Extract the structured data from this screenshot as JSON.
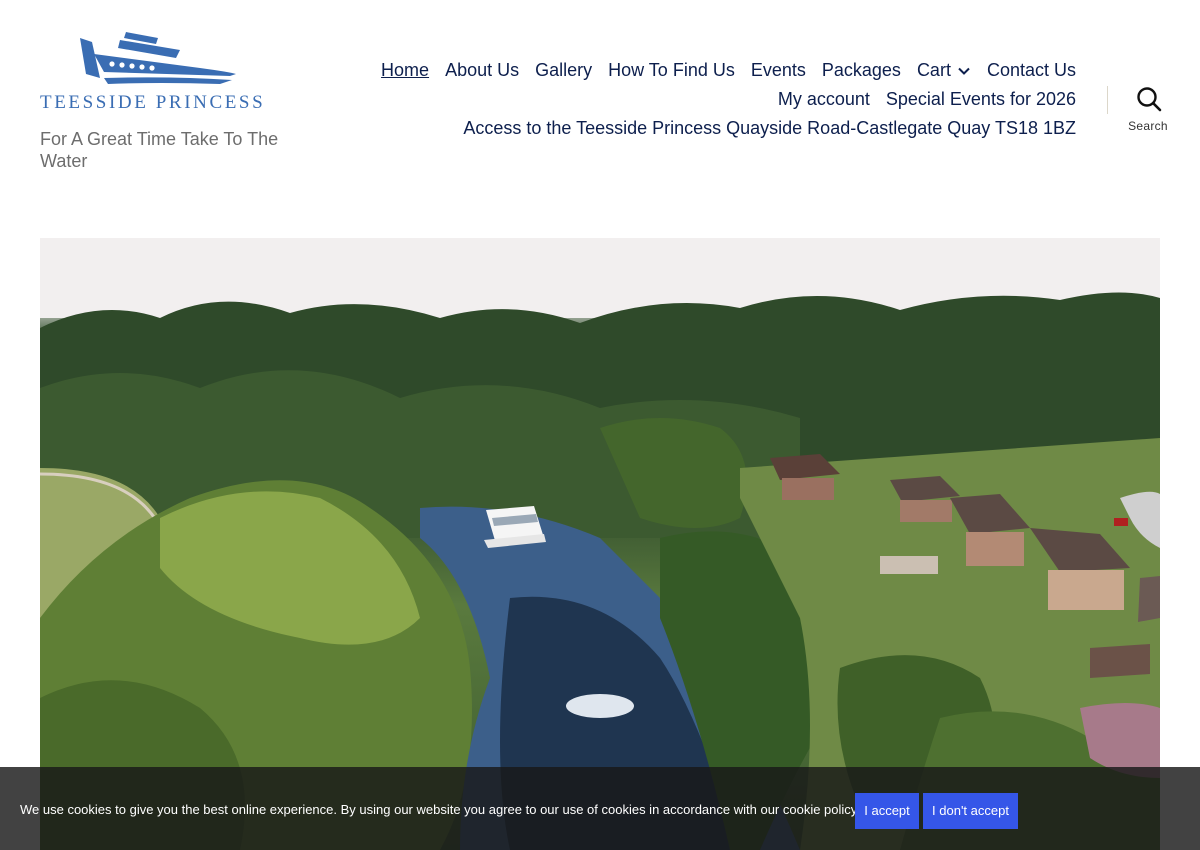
{
  "site": {
    "logo_text": "TEESSIDE PRINCESS",
    "tagline": "For A Great Time Take To The Water"
  },
  "nav": {
    "row1": [
      {
        "label": "Home",
        "current": true
      },
      {
        "label": "About Us"
      },
      {
        "label": "Gallery"
      },
      {
        "label": "How To Find Us"
      },
      {
        "label": "Events"
      },
      {
        "label": "Packages"
      },
      {
        "label": "Cart",
        "has_submenu": true
      },
      {
        "label": "Contact Us"
      }
    ],
    "row2": [
      {
        "label": "My account"
      },
      {
        "label": "Special Events for 2026"
      }
    ],
    "row3": [
      {
        "label": "Access to the Teesside Princess Quayside Road-Castlegate Quay TS18 1BZ"
      }
    ]
  },
  "search": {
    "label": "Search",
    "icon": "magnifier-icon"
  },
  "hero": {
    "image": "aerial-river-boat-photo"
  },
  "cookie": {
    "text": "We use cookies to give you the best online experience. By using our website you agree to our use of cookies in accordance with our cookie policy.",
    "accept_label": "I accept",
    "decline_label": "I don't accept"
  },
  "colors": {
    "nav_text": "#0d1f4d",
    "logo_blue": "#3a6db3",
    "button_blue": "#3556e8",
    "tagline_gray": "#6d6d6d"
  }
}
